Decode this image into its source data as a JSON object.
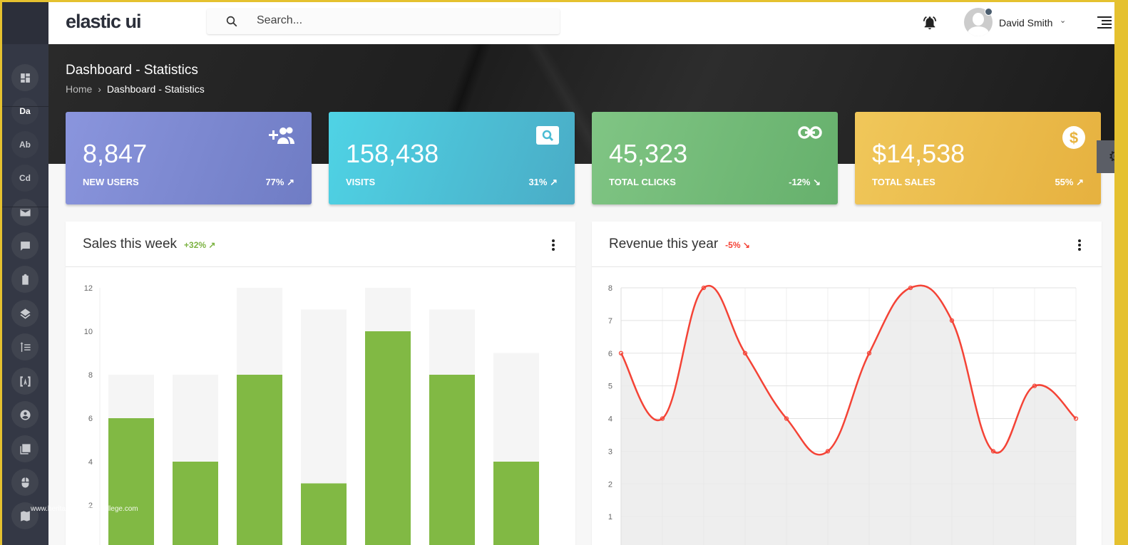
{
  "app": {
    "logo": "elastic ui"
  },
  "search": {
    "placeholder": "Search..."
  },
  "user": {
    "name": "David Smith"
  },
  "sidebar": {
    "items": [
      {
        "icon": "dashboard-icon"
      },
      {
        "label": "Da"
      },
      {
        "label": "Ab"
      },
      {
        "label": "Cd"
      },
      {
        "icon": "mail-icon"
      },
      {
        "icon": "chat-icon"
      },
      {
        "icon": "clipboard-icon"
      },
      {
        "icon": "layers-icon"
      },
      {
        "icon": "list-icon"
      },
      {
        "icon": "text-box-icon"
      },
      {
        "icon": "account-circle-icon"
      },
      {
        "icon": "library-books-icon"
      },
      {
        "icon": "mouse-icon"
      },
      {
        "icon": "map-icon"
      }
    ]
  },
  "page": {
    "title": "Dashboard - Statistics",
    "breadcrumb": [
      "Home",
      "Dashboard - Statistics"
    ]
  },
  "stats": [
    {
      "value": "8,847",
      "label": "NEW USERS",
      "change": "77%",
      "trend": "up",
      "icon": "add-group-icon",
      "colors": [
        "#8a95dd",
        "#6f7cc4"
      ]
    },
    {
      "value": "158,438",
      "label": "VISITS",
      "change": "31%",
      "trend": "up",
      "icon": "search-icon",
      "colors": [
        "#4fd3e5",
        "#4aacc6"
      ]
    },
    {
      "value": "45,323",
      "label": "TOTAL CLICKS",
      "change": "-12%",
      "trend": "down",
      "icon": "link-icon",
      "colors": [
        "#80c584",
        "#66b06c"
      ]
    },
    {
      "value": "$14,538",
      "label": "TOTAL SALES",
      "change": "55%",
      "trend": "up",
      "icon": "dollar-icon",
      "colors": [
        "#f0c75a",
        "#e6b13f"
      ]
    }
  ],
  "watermark": "www.heritagechristiancollege.com",
  "chart_data": [
    {
      "type": "bar",
      "title": "Sales this week",
      "trend": "+32%",
      "trend_color": "#7cb342",
      "ylim": [
        0,
        12
      ],
      "yticks": [
        2,
        4,
        6,
        8,
        10,
        12
      ],
      "series": [
        {
          "values": [
            8,
            8,
            12,
            11,
            12,
            11,
            9
          ],
          "color": "#f5f5f5"
        },
        {
          "values": [
            6,
            4,
            8,
            3,
            10,
            8,
            4
          ],
          "color": "#81b944"
        }
      ]
    },
    {
      "type": "area",
      "title": "Revenue this year",
      "trend": "-5%",
      "trend_color": "#f44336",
      "ylim": [
        0,
        8
      ],
      "yticks": [
        1,
        2,
        3,
        4,
        5,
        6,
        7,
        8
      ],
      "values": [
        6,
        4,
        8,
        6,
        4,
        3,
        6,
        8,
        7,
        3,
        5,
        4
      ],
      "line_color": "#f44336",
      "fill_color": "#ebebeb"
    }
  ]
}
